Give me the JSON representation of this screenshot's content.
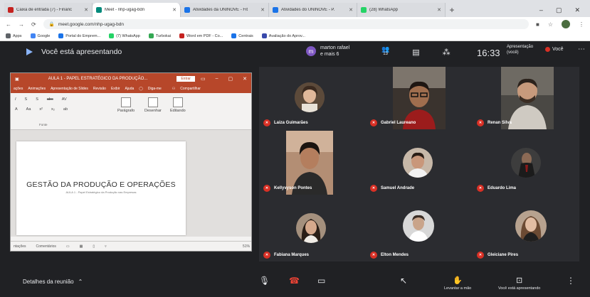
{
  "browser": {
    "tabs": [
      {
        "label": "Caixa de entrada (7) - Financ",
        "active": false,
        "color": "#c5221f"
      },
      {
        "label": "Meet - nhp-ugag-bdn",
        "active": true,
        "color": "#00897b"
      },
      {
        "label": "Atividades da UNINOVE - Fit",
        "active": false,
        "color": "#1a73e8"
      },
      {
        "label": "Atividades do UNINOVE - P.",
        "active": false,
        "color": "#1a73e8"
      },
      {
        "label": "(28) WhatsApp",
        "active": false,
        "color": "#25d366"
      }
    ],
    "url": "meet.google.com/nhp-ugag-bdn",
    "bookmarks": [
      {
        "label": "Apps",
        "color": "#5f6368"
      },
      {
        "label": "Google",
        "color": "#4285f4"
      },
      {
        "label": "Portal do Emprem...",
        "color": "#1a73e8"
      },
      {
        "label": "(7) WhatsApp",
        "color": "#25d366"
      },
      {
        "label": "Turbokai",
        "color": "#34a853"
      },
      {
        "label": "Word em PDF - Co...",
        "color": "#c5221f"
      },
      {
        "label": "Centrais",
        "color": "#1a73e8"
      },
      {
        "label": "Avaliação do Aprov...",
        "color": "#3949ab"
      }
    ]
  },
  "meet": {
    "presenting_text": "Você está apresentando",
    "people_line1": "marton rafael",
    "people_line2": "e mais 6",
    "chip_initial": "m",
    "count_label": "13",
    "clock": "16:33",
    "presentation_tab_line1": "Apresentação",
    "presentation_tab_line2": "(você)",
    "you_label": "Você",
    "details_label": "Detalhes da reunião",
    "raise_hand_label": "Levantar a mão",
    "presenting_btn_label": "Você está apresentando"
  },
  "ppt": {
    "doc_title": "AULA 1 - PAPEL ESTRATÉGICO DA PRODUÇÃO...",
    "signin_label": "Entrar",
    "menu": [
      "ações",
      "Animações",
      "Apresentação de Slides",
      "Revisão",
      "Exibir",
      "Ajuda",
      "Diga-me",
      "Compartilhar"
    ],
    "ribbon_groups": [
      "Parágrafo",
      "Desenhar",
      "Editando"
    ],
    "ribbon_caption": "Fonte",
    "slide_title": "GESTÃO DA PRODUÇÃO E OPERAÇÕES",
    "slide_subtitle": "AULA 1 - Papel Estratégico da Produção nas Empresas",
    "status_left": "ntações",
    "status_comments": "Comentários",
    "zoom": "51%"
  },
  "participants": [
    {
      "name": "Laiza Guimarães",
      "kind": "avatar",
      "bg": "#5c4a3a"
    },
    {
      "name": "Gabriel Laureano",
      "kind": "video",
      "bg": "#3a332e"
    },
    {
      "name": "Renan Silva",
      "kind": "video",
      "bg": "#4a4844"
    },
    {
      "name": "Kellyvyson Pontes",
      "kind": "video",
      "bg": "#5b4a3f"
    },
    {
      "name": "Samuel Andrade",
      "kind": "avatar",
      "bg": "#c7b8a8"
    },
    {
      "name": "Eduardo Lima",
      "kind": "avatar",
      "bg": "#3d3d3d"
    },
    {
      "name": "Fabiana Marques",
      "kind": "avatar",
      "bg": "#a4907d"
    },
    {
      "name": "Elton Mendes",
      "kind": "avatar",
      "bg": "#d8d8d8"
    },
    {
      "name": "Gleiciane Pires",
      "kind": "avatar",
      "bg": "#b7a28f"
    }
  ]
}
